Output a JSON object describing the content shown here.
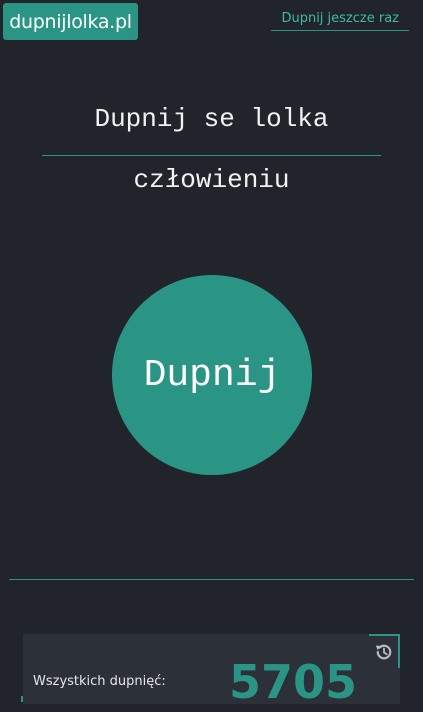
{
  "header": {
    "logo_text": "dupnijlolka.pl",
    "again_link": "Dupnij jeszcze raz"
  },
  "main": {
    "headline": "Dupnij se lolka",
    "subline": "człowieniu",
    "button_label": "Dupnij"
  },
  "stats": {
    "label": "Wszystkich dupnięć:",
    "count": "5705",
    "icon": "history-icon"
  },
  "colors": {
    "background": "#21252b",
    "accent": "#2a9584",
    "card": "#2c3038"
  }
}
